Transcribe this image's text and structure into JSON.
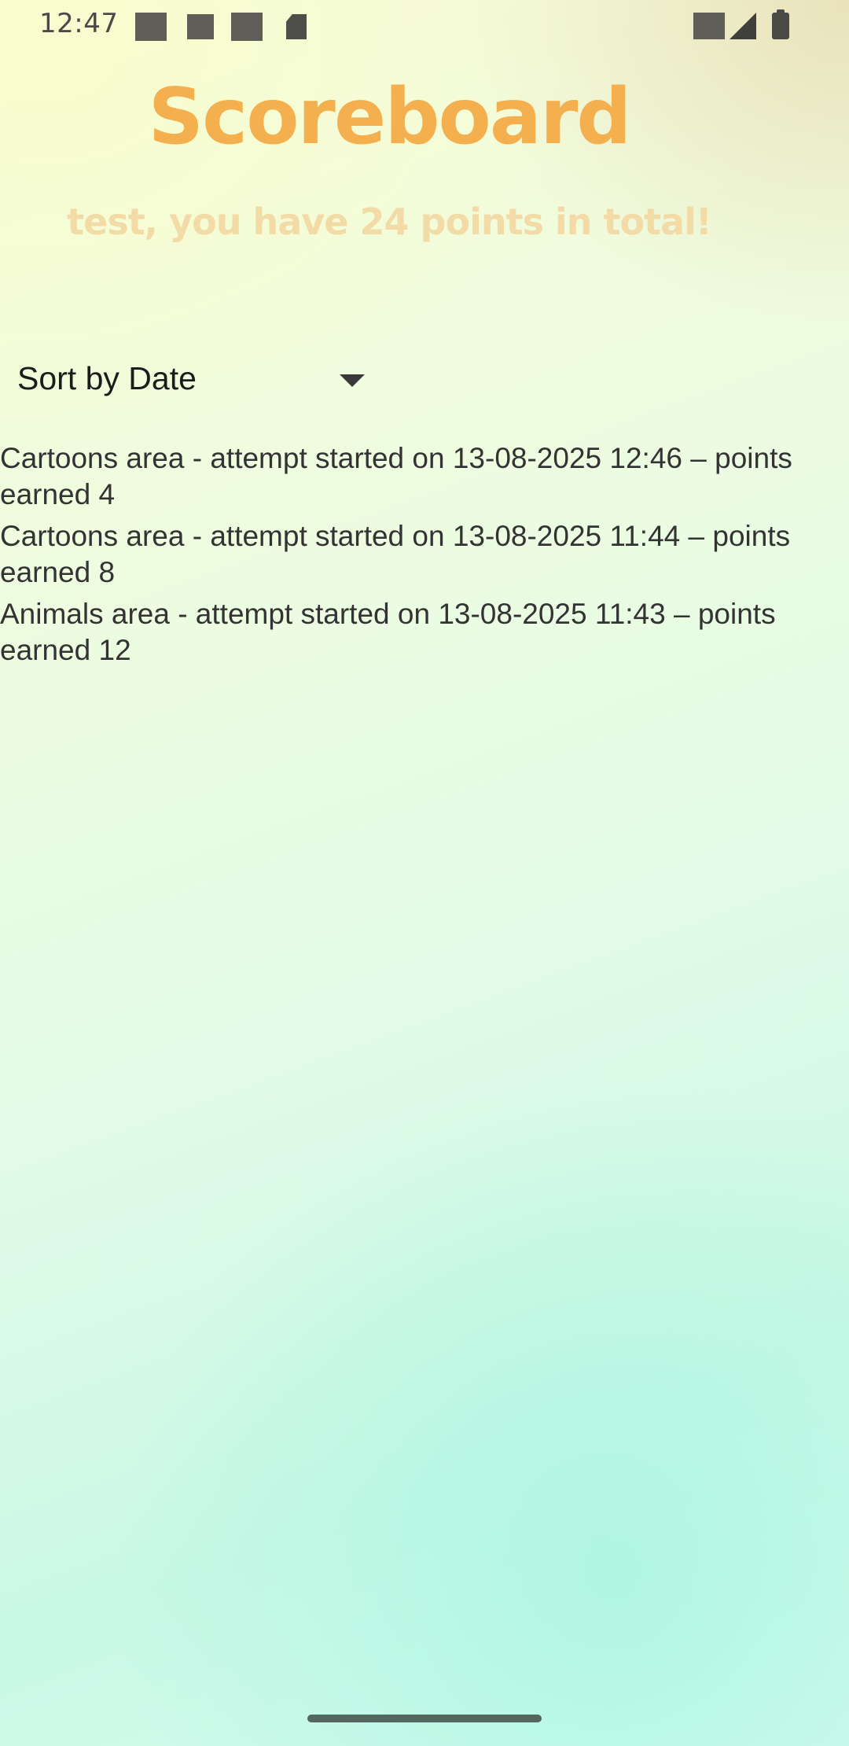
{
  "status_bar": {
    "time": "12:47",
    "notification_icons": [
      "notification-icon",
      "notification-icon",
      "notification-icon",
      "sd-card-icon"
    ],
    "system_icons": [
      "wifi-icon",
      "signal-icon",
      "battery-icon"
    ]
  },
  "header": {
    "title": "Scoreboard",
    "subtitle": "test, you have 24 points in total!",
    "title_color": "#f4b04e",
    "subtitle_color": "#f2dba6"
  },
  "sort": {
    "selected": "Sort by Date",
    "icon": "dropdown-arrow-icon"
  },
  "attempts": [
    "Cartoons area - attempt started on 13-08-2025 12:46 – points earned 4",
    "Cartoons area - attempt started on 13-08-2025 11:44 – points earned 8",
    "Animals area - attempt started on 13-08-2025 11:43 – points earned 12"
  ]
}
